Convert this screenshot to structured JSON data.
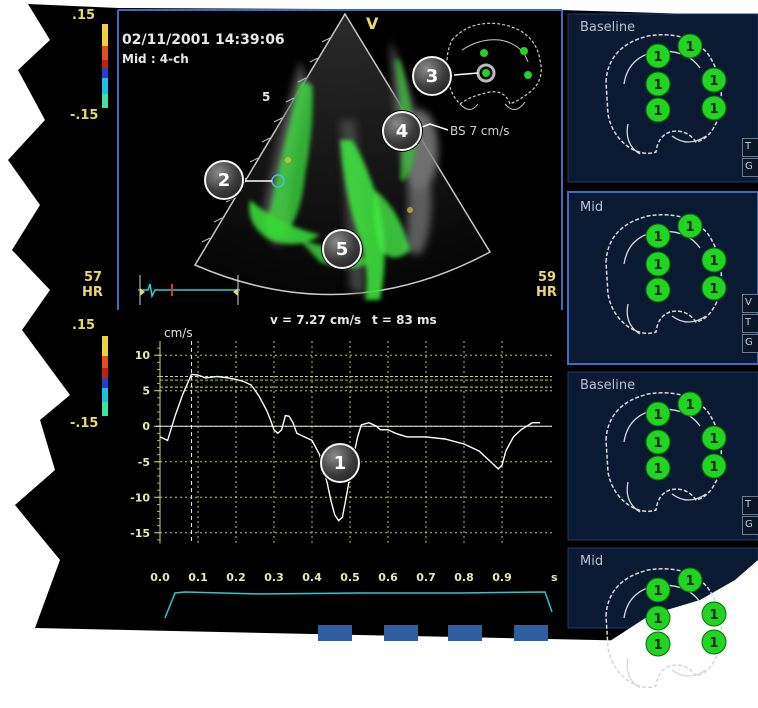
{
  "echo": {
    "datetime": "02/11/2001 14:39:06",
    "view": "Mid : 4-ch",
    "scale_top": ".15",
    "scale_bottom": "-.15",
    "depth_mark": "5",
    "v_marker": "V",
    "hr_left_value": "57",
    "hr_left_label": "HR",
    "hr_right_value": "59",
    "hr_right_label": "HR",
    "bs_label": "BS 7 cm/s"
  },
  "readout": {
    "velocity": "v = 7.27 cm/s",
    "time": "t = 83 ms"
  },
  "curve_panel": {
    "scale_top": ".15",
    "scale_bottom": "-.15",
    "unit": "cm/s"
  },
  "chart_data": {
    "type": "line",
    "title": "",
    "xlabel": "s",
    "ylabel": "cm/s",
    "xlim": [
      0.0,
      1.0
    ],
    "ylim": [
      -17,
      12
    ],
    "grid": true,
    "x_ticks": [
      "0.0",
      "0.1",
      "0.2",
      "0.3",
      "0.4",
      "0.5",
      "0.6",
      "0.7",
      "0.8",
      "0.9"
    ],
    "y_ticks": [
      "10",
      "5",
      "0",
      "-5",
      "-10",
      "-15"
    ],
    "reference_lines": [
      6.5,
      7.0,
      5.5
    ],
    "cursor_x": 0.083,
    "series": [
      {
        "x": [
          0.0,
          0.02,
          0.04,
          0.06,
          0.083,
          0.1,
          0.12,
          0.15,
          0.18,
          0.2,
          0.22,
          0.24,
          0.26,
          0.28,
          0.29,
          0.3,
          0.31,
          0.32,
          0.33,
          0.34,
          0.35,
          0.36,
          0.38,
          0.4,
          0.42,
          0.44,
          0.45,
          0.46,
          0.47,
          0.48,
          0.49,
          0.5,
          0.51,
          0.52,
          0.53,
          0.55,
          0.57,
          0.58,
          0.6,
          0.62,
          0.65,
          0.7,
          0.75,
          0.8,
          0.84,
          0.87,
          0.89,
          0.9,
          0.91,
          0.93,
          0.95,
          0.98,
          1.0
        ],
        "y": [
          -1.5,
          -2.0,
          1.5,
          4.5,
          7.3,
          7.2,
          6.8,
          7.0,
          6.8,
          6.6,
          6.3,
          5.8,
          4.3,
          2.3,
          1.0,
          -0.5,
          -1.0,
          -0.5,
          1.5,
          1.4,
          0.5,
          -1.0,
          -1.5,
          -2.0,
          -4.0,
          -8.0,
          -10.5,
          -12.5,
          -13.3,
          -12.8,
          -10.0,
          -7.0,
          -4.0,
          -1.5,
          0.2,
          0.5,
          0.0,
          -0.5,
          -0.5,
          -1.0,
          -1.5,
          -1.5,
          -1.8,
          -2.5,
          -3.5,
          -5.0,
          -6.0,
          -5.5,
          -3.5,
          -1.5,
          -0.5,
          0.5,
          0.5
        ]
      }
    ]
  },
  "badges": {
    "b1": "1",
    "b2": "2",
    "b3": "3",
    "b4": "4",
    "b5": "5"
  },
  "right_panels": [
    {
      "label": "Baseline",
      "segment": "1",
      "tabs": [
        "T",
        "G"
      ]
    },
    {
      "label": "Mid",
      "segment": "1",
      "tabs": [
        "V",
        "T",
        "G"
      ]
    },
    {
      "label": "Baseline",
      "segment": "1",
      "tabs": [
        "T",
        "G"
      ]
    },
    {
      "label": "Mid",
      "segment": "1",
      "tabs": []
    }
  ],
  "colors": {
    "background": "#000000",
    "frame_blue": "#3c6cc4",
    "panel_bg": "#0a1a33",
    "segment_green": "#22d422",
    "doppler_green": "#3fe03f",
    "grid_yellow": "#d8d870",
    "curve": "#ffffff"
  }
}
